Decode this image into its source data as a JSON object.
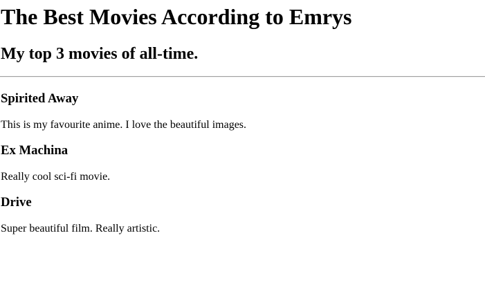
{
  "page": {
    "title": "The Best Movies According to Emrys",
    "subtitle": "My top 3 movies of all-time."
  },
  "movies": [
    {
      "name": "Spirited Away",
      "description": "This is my favourite anime. I love the beautiful images."
    },
    {
      "name": "Ex Machina",
      "description": "Really cool sci-fi movie."
    },
    {
      "name": "Drive",
      "description": "Super beautiful film. Really artistic."
    }
  ]
}
